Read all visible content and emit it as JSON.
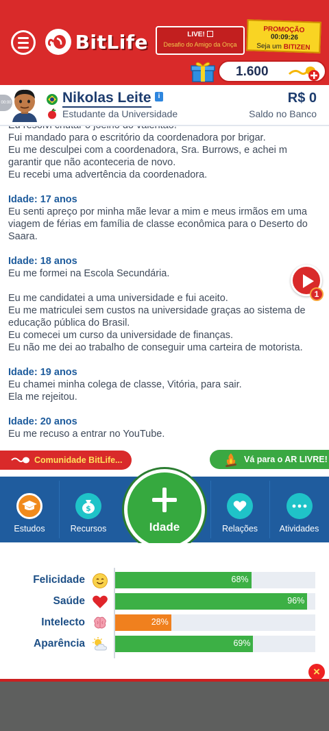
{
  "header": {
    "app_name": "BitLife",
    "live_title": "LIVE!",
    "live_subtitle": "Desafio do Amigo da Onça",
    "promo_label": "PROMOÇÃO",
    "promo_timer": "00:09:26",
    "promo_sub_prefix": "Seja um ",
    "promo_sub_brand": "BITIZEN",
    "currency_amount": "1.600"
  },
  "profile": {
    "name": "Nikolas Leite",
    "occupation": "Estudante da Universidade",
    "money": "R$ 0",
    "money_label": "Saldo no Banco",
    "side_pill": "00:00"
  },
  "log": {
    "lines_top": [
      "Eu resolvi chutar o joelho do valentão!",
      "Fui mandado para o escritório da coordenadora por brigar.",
      "Eu me desculpei com a coordenadora, Sra. Burrows, e achei m",
      "garantir que não aconteceria de novo.",
      "Eu recebi uma advertência da coordenadora."
    ],
    "age17": "Idade: 17 anos",
    "age17_lines": [
      "Eu senti apreço por minha mãe levar a mim e meus irmãos em uma",
      "viagem de férias em família de classe econômica para o Deserto do",
      "Saara."
    ],
    "age18": "Idade: 18 anos",
    "age18_line1": "Eu me formei na Escola Secundária.",
    "age18_lines": [
      "Eu me candidatei a uma universidade e fui aceito.",
      "Eu me matriculei sem custos na universidade graças ao sistema de",
      "educação pública do Brasil.",
      "Eu comecei um curso da universidade de finanças.",
      "Eu não me dei ao trabalho de conseguir uma carteira de motorista."
    ],
    "age19": "Idade: 19 anos",
    "age19_lines": [
      "Eu chamei minha colega de classe, Vitória, para sair.",
      "Ela me rejeitou."
    ],
    "age20": "Idade: 20 anos",
    "age20_lines": [
      "Eu me recuso a entrar no YouTube."
    ],
    "play_badge": "1"
  },
  "banners": {
    "community": "Comunidade BitLife...",
    "outdoor": "Vá para o AR LIVRE!"
  },
  "nav": {
    "studies": "Estudos",
    "resources": "Recursos",
    "age": "Idade",
    "relations": "Relações",
    "activities": "Atividades"
  },
  "stats": [
    {
      "label": "Felicidade",
      "value": 68,
      "text": "68%",
      "color": "#3cb045",
      "icon": "smile-icon"
    },
    {
      "label": "Saúde",
      "value": 96,
      "text": "96%",
      "color": "#3cb045",
      "icon": "heart-icon"
    },
    {
      "label": "Intelecto",
      "value": 28,
      "text": "28%",
      "color": "#f0801e",
      "icon": "brain-icon"
    },
    {
      "label": "Aparência",
      "value": 69,
      "text": "69%",
      "color": "#3cb045",
      "icon": "sun-cloud-icon"
    }
  ],
  "close_label": "×"
}
